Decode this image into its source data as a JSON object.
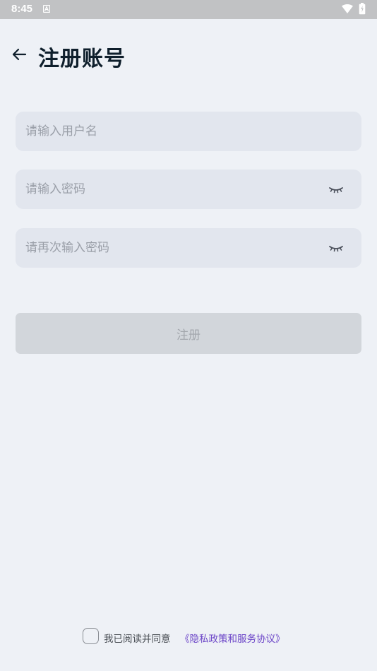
{
  "status_bar": {
    "time": "8:45"
  },
  "header": {
    "title": "注册账号"
  },
  "form": {
    "username_placeholder": "请输入用户名",
    "password_placeholder": "请输入密码",
    "confirm_password_placeholder": "请再次输入密码",
    "submit_label": "注册"
  },
  "agreement": {
    "text": "我已阅读并同意",
    "link_label": "《隐私政策和服务协议》"
  },
  "colors": {
    "background": "#eef1f6",
    "field_background": "#e2e6ee",
    "button_disabled": "#d2d6db",
    "link": "#6a43c7",
    "title": "#0f1f2c"
  },
  "icons": [
    "back-arrow-icon",
    "eye-closed-icon",
    "wifi-icon",
    "battery-icon",
    "notification-a-icon"
  ]
}
